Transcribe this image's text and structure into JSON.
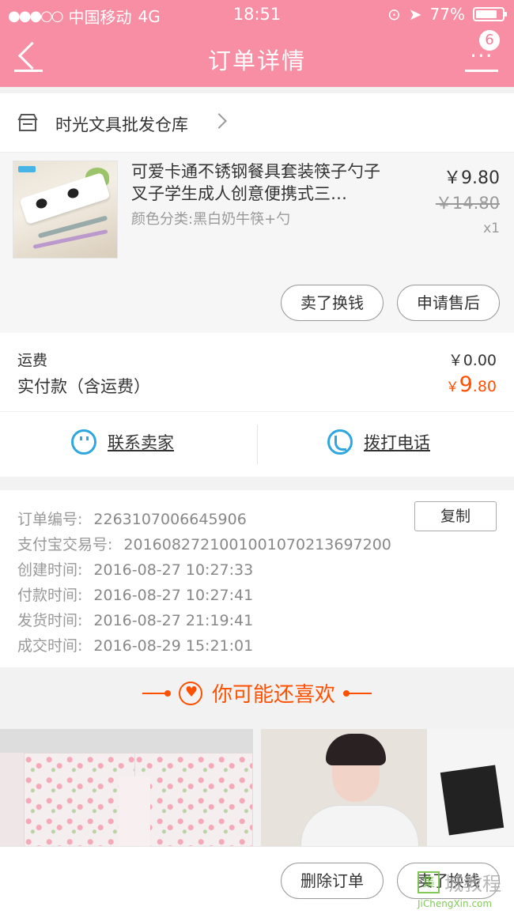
{
  "status_bar": {
    "signal": "●●●○○",
    "carrier": "中国移动",
    "network": "4G",
    "time": "18:51",
    "battery": "77%"
  },
  "header": {
    "title": "订单详情",
    "badge_count": "6",
    "back_icon": "back-arrow-icon",
    "more_icon": "more-dots-icon"
  },
  "shop": {
    "name": "时光文具批发仓库",
    "icon": "store-icon"
  },
  "item": {
    "name": "可爱卡通不锈钢餐具套装筷子勺子叉子学生成人创意便携式三…",
    "sku": "颜色分类:黑白奶牛筷+勺",
    "price": "￥9.80",
    "original_price": "￥14.80",
    "quantity": "x1",
    "buttons": {
      "sell": "卖了换钱",
      "after_sale": "申请售后"
    }
  },
  "fees": {
    "shipping_label": "运费",
    "shipping_value": "￥0.00",
    "paid_label": "实付款（含运费）",
    "paid_currency": "￥",
    "paid_integer": "9",
    "paid_decimal": ".80"
  },
  "contact": {
    "seller": "联系卖家",
    "phone": "拨打电话"
  },
  "order_info": {
    "copy_label": "复制",
    "rows": [
      {
        "label": "订单编号:",
        "value": "2263107006645906"
      },
      {
        "label": "支付宝交易号:",
        "value": "2016082721001001070213697200"
      },
      {
        "label": "创建时间:",
        "value": "2016-08-27 10:27:33"
      },
      {
        "label": "付款时间:",
        "value": "2016-08-27 10:27:41"
      },
      {
        "label": "发货时间:",
        "value": "2016-08-27 21:19:41"
      },
      {
        "label": "成交时间:",
        "value": "2016-08-29 15:21:01"
      }
    ]
  },
  "recommend": {
    "title": "你可能还喜欢"
  },
  "bottom_bar": {
    "delete": "删除订单",
    "sell": "卖了换钱"
  },
  "watermark": {
    "logo_text": "集",
    "text": "城教程",
    "url": "JiChengXin.com"
  },
  "colors": {
    "header": "#f88ea4",
    "accent": "#ff5000",
    "link_blue": "#2ea7e0"
  }
}
